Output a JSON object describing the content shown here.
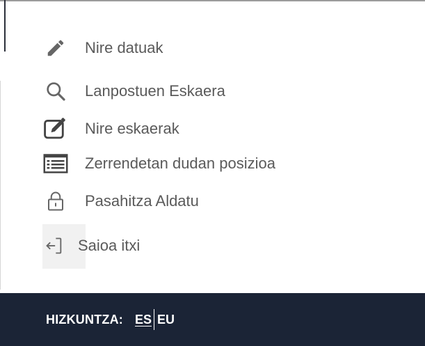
{
  "menu": {
    "items": [
      {
        "label": "Nire datuak",
        "icon": "pencil-icon"
      },
      {
        "label": "Lanpostuen Eskaera",
        "icon": "search-icon"
      },
      {
        "label": "Nire eskaerak",
        "icon": "edit-document-icon"
      },
      {
        "label": "Zerrendetan dudan posizioa",
        "icon": "list-icon"
      },
      {
        "label": "Pasahitza Aldatu",
        "icon": "lock-icon"
      },
      {
        "label": "Saioa itxi",
        "icon": "logout-icon"
      }
    ]
  },
  "footer": {
    "language_label": "HIZKUNTZA:",
    "languages": [
      "ES",
      "EU"
    ],
    "active_language": "ES"
  },
  "colors": {
    "footer_bg": "#1b2436",
    "menu_text": "#5a5a5a",
    "icon": "#666666",
    "list_icon": "#444444"
  }
}
